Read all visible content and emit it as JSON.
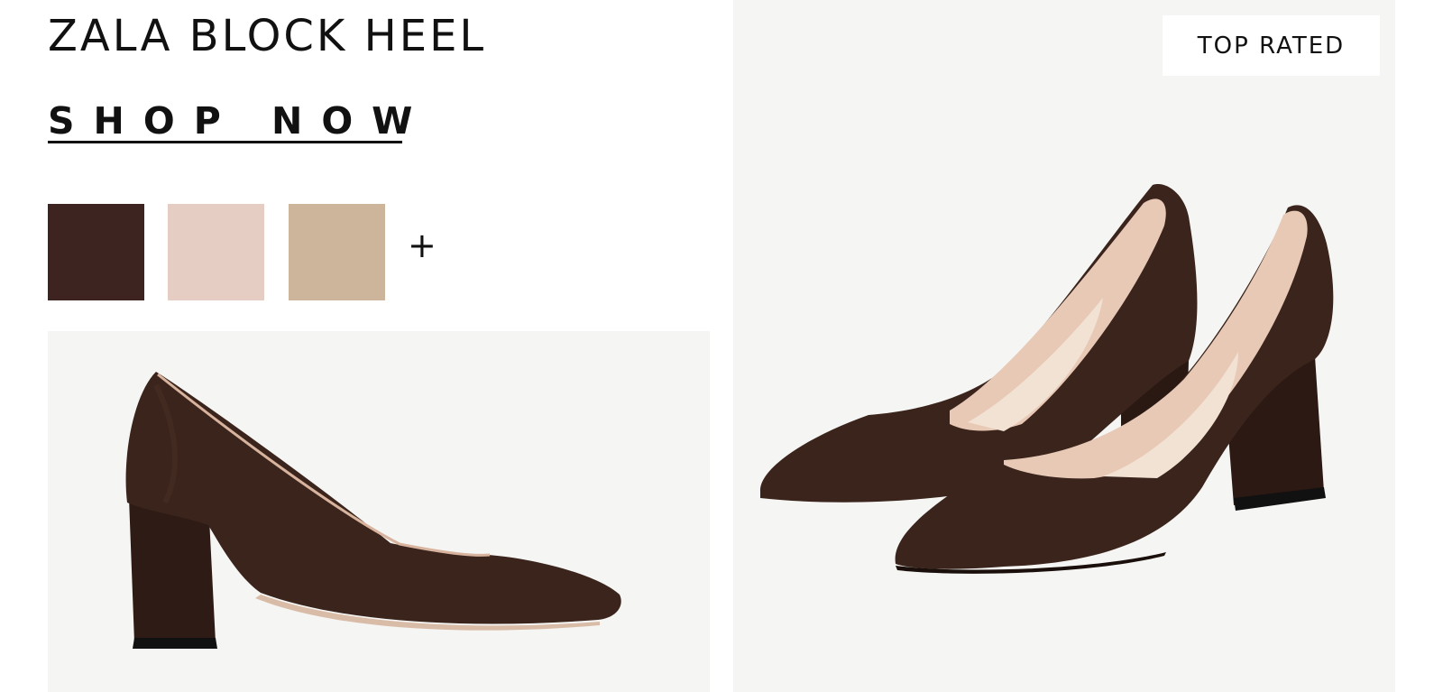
{
  "product": {
    "title": "ZALA BLOCK HEEL",
    "cta_label": "SHOP NOW"
  },
  "swatches": [
    {
      "name": "dark-brown-suede",
      "color": "#3d2420"
    },
    {
      "name": "blush",
      "color": "#e6cdc4"
    },
    {
      "name": "nude",
      "color": "#ccb59b"
    }
  ],
  "more_swatches_label": "+",
  "badge": {
    "label": "TOP RATED"
  },
  "colors": {
    "shoe": "#3a241c",
    "shoe_shadow": "#2a1812",
    "lining": "#e8c9b6",
    "lining_light": "#f2e2d4",
    "panel_bg": "#f5f5f3"
  }
}
